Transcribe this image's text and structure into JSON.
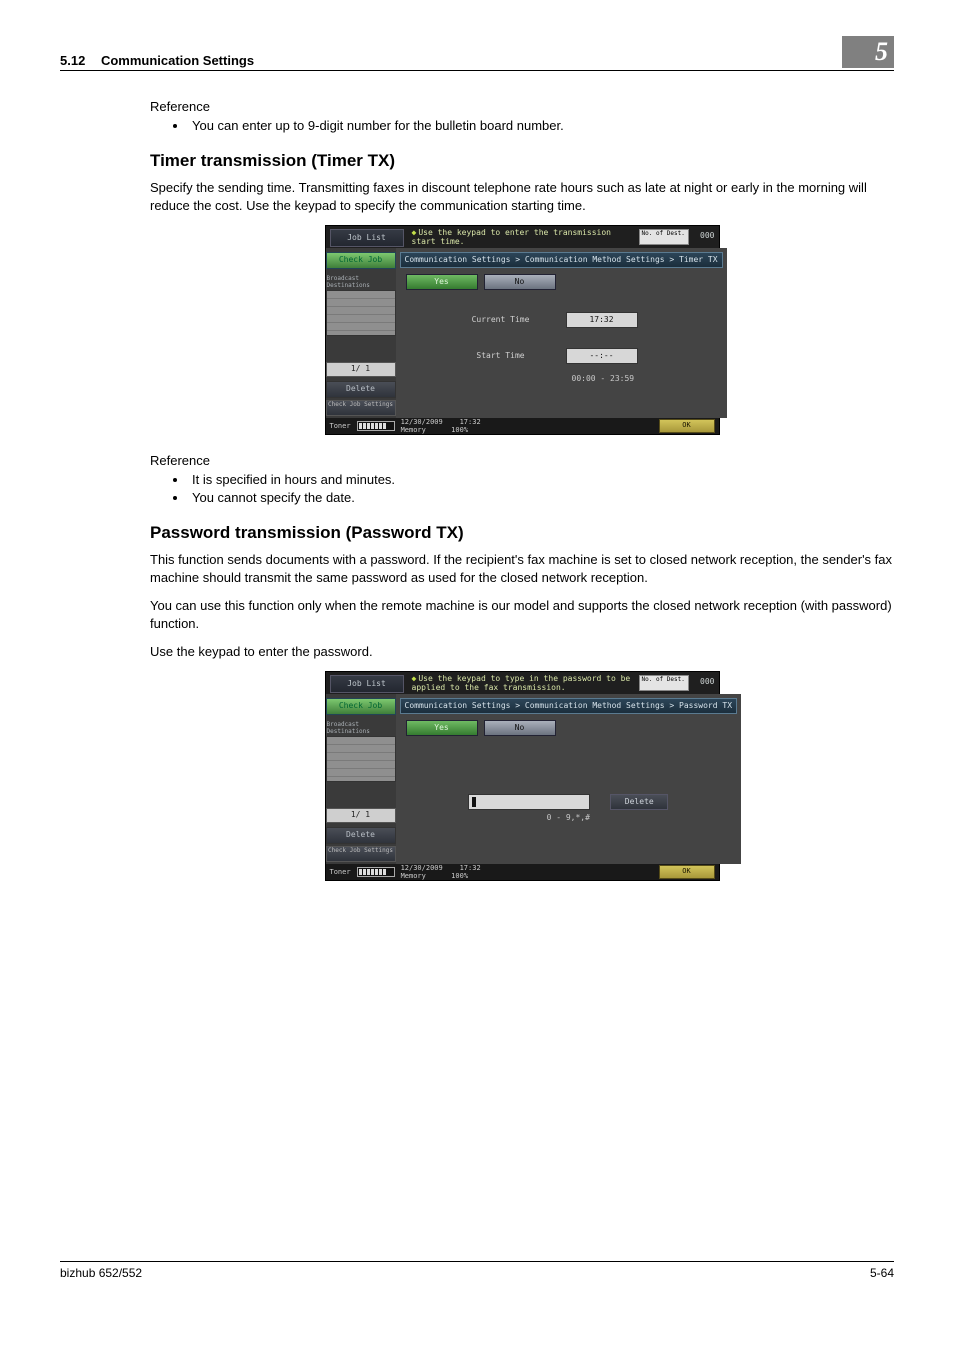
{
  "header": {
    "section_num": "5.12",
    "section_title": "Communication Settings",
    "chapter_num": "5"
  },
  "ref1": {
    "label": "Reference",
    "items": [
      "You can enter up to 9-digit number for the bulletin board number."
    ]
  },
  "sect1": {
    "title": "Timer transmission (Timer TX)",
    "para": "Specify the sending time. Transmitting faxes in discount telephone rate hours such as late at night or early in the morning will reduce the cost. Use the keypad to specify the communication starting time."
  },
  "panel_timer": {
    "job_list": "Job List",
    "check_job": "Check Job",
    "hint": "Use the keypad to enter the transmission start time.",
    "dest_label": "No. of Dest.",
    "dest_count": "000",
    "breadcrumb": "Communication Settings > Communication Method Settings > Timer TX",
    "yes": "Yes",
    "no": "No",
    "broadcast_label": "Broadcast Destinations",
    "current_time_label": "Current Time",
    "current_time_value": "17:32",
    "start_time_label": "Start Time",
    "start_time_value": "--:--",
    "range": "00:00  -  23:59",
    "pager": "1/  1",
    "delete": "Delete",
    "check_settings": "Check Job Settings",
    "toner_label": "Toner",
    "date": "12/30/2009",
    "time": "17:32",
    "memory_label": "Memory",
    "memory_value": "100%",
    "ok": "OK"
  },
  "ref2": {
    "label": "Reference",
    "items": [
      "It is specified in hours and minutes.",
      "You cannot specify the date."
    ]
  },
  "sect2": {
    "title": "Password transmission (Password TX)",
    "para1": "This function sends documents with a password. If the recipient's fax machine is set to closed network reception, the sender's fax machine should transmit the same password as used for the closed network reception.",
    "para2": "You can use this function only when the remote machine is our model and supports the closed network reception (with password) function.",
    "para3": "Use the keypad to enter the password."
  },
  "panel_pw": {
    "hint": "Use the keypad to type in the password to be applied to the fax transmission.",
    "breadcrumb": "Communication Settings > Communication Method Settings > Password TX",
    "charset": "0 - 9,*,#",
    "delete_btn": "Delete"
  },
  "footer": {
    "left": "bizhub 652/552",
    "right": "5-64"
  }
}
